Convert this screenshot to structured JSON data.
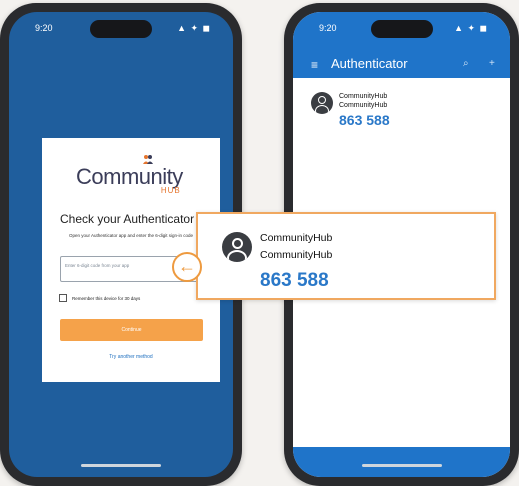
{
  "left_phone": {
    "status_time": "9:20",
    "status_icons": "▲ ✦ ◼",
    "logo_text": "Community",
    "logo_sub": "HUB",
    "heading": "Check your Authenticator Ap",
    "instructions": "Open your Authenticator app and enter the 6-digit sign-in code",
    "code_placeholder": "Enter 6-digit code from your app",
    "remember_label": "Remember this device for 30 days",
    "continue_label": "Continue",
    "other_method_label": "Try another method"
  },
  "right_phone": {
    "status_time": "9:20",
    "status_icons": "▲ ✦ ◼",
    "app_title": "Authenticator",
    "menu_icon": "≡",
    "header_icons": [
      "⌕",
      "+"
    ],
    "account": {
      "issuer": "CommunityHub",
      "name": "CommunityHub",
      "code": "863 588"
    }
  },
  "callout": {
    "issuer": "CommunityHub",
    "name": "CommunityHub",
    "code": "863 588",
    "arrow_icon": "←"
  },
  "colors": {
    "brand_blue": "#1f74c9",
    "left_bg": "#1f5e9d",
    "accent_orange": "#f5a24a",
    "code_blue": "#2a78c8"
  }
}
